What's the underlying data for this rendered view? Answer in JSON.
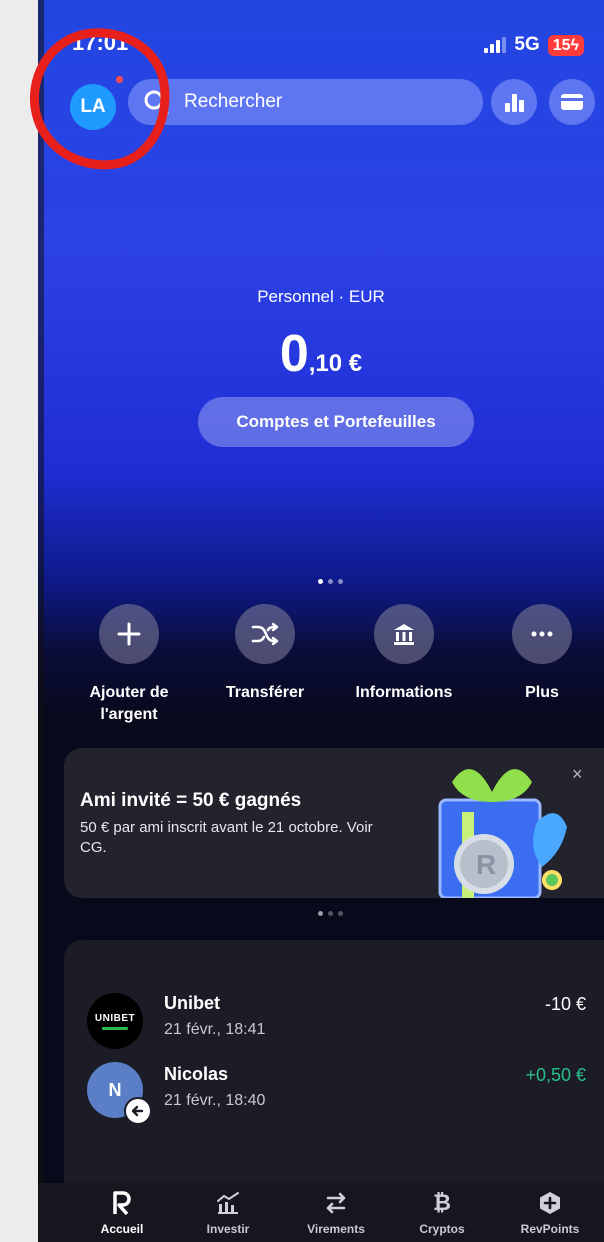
{
  "status": {
    "time": "17:01",
    "network": "5G",
    "battery": "15"
  },
  "header": {
    "avatar_initials": "LA",
    "search_placeholder": "Rechercher"
  },
  "balance": {
    "label": "Personnel · EUR",
    "integer": "0",
    "decimal": ",10 €",
    "accounts_button": "Comptes et Portefeuilles"
  },
  "actions": [
    {
      "label": "Ajouter de l'argent",
      "icon": "plus-icon"
    },
    {
      "label": "Transférer",
      "icon": "shuffle-icon"
    },
    {
      "label": "Informations",
      "icon": "bank-icon"
    },
    {
      "label": "Plus",
      "icon": "more-icon"
    }
  ],
  "promo": {
    "title": "Ami invité = 50 € gagnés",
    "text": "50 € par ami inscrit avant le 21 octobre. Voir CG.",
    "close": "×"
  },
  "transactions": [
    {
      "name": "Unibet",
      "date": "21 févr., 18:41",
      "amount": "-10 €",
      "logo_text": "UNIBET"
    },
    {
      "name": "Nicolas",
      "date": "21 févr., 18:40",
      "amount": "+0,50 €",
      "initial": "N"
    }
  ],
  "tabs": [
    {
      "label": "Accueil",
      "icon": "revolut-r-icon",
      "active": true
    },
    {
      "label": "Investir",
      "icon": "invest-icon"
    },
    {
      "label": "Virements",
      "icon": "transfer-arrows-icon"
    },
    {
      "label": "Cryptos",
      "icon": "bitcoin-icon"
    },
    {
      "label": "RevPoints",
      "icon": "revpoints-icon"
    }
  ],
  "colors": {
    "accent": "#2c41e6",
    "positive": "#27c08a",
    "annotation": "#e8201c",
    "avatar": "#1f9bff"
  }
}
